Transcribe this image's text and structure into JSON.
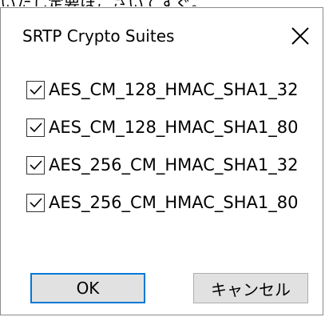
{
  "background_text": "いたし定要ほこさいてすぐ。",
  "dialog": {
    "title": "SRTP Crypto Suites",
    "close_symbol": "×",
    "options": [
      {
        "label": "AES_CM_128_HMAC_SHA1_32",
        "checked": true
      },
      {
        "label": "AES_CM_128_HMAC_SHA1_80",
        "checked": true
      },
      {
        "label": "AES_256_CM_HMAC_SHA1_32",
        "checked": true
      },
      {
        "label": "AES_256_CM_HMAC_SHA1_80",
        "checked": true
      }
    ],
    "ok_label": "OK",
    "cancel_label": "キャンセル"
  },
  "colors": {
    "dialog_border": "#8c8c8c",
    "ok_focus_border": "#0078d7",
    "button_face": "#e1e1e1",
    "checkbox_border": "#333333"
  }
}
